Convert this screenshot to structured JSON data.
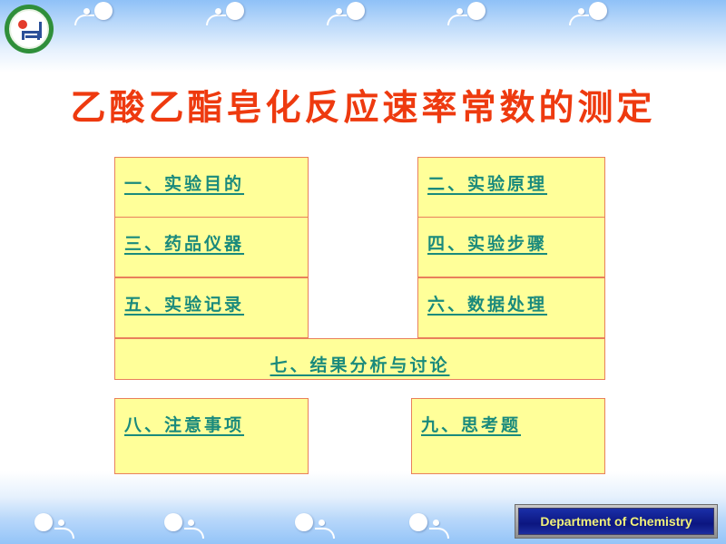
{
  "slide": {
    "title": "乙酸乙酯皂化反应速率常数的测定",
    "colors": {
      "title": "#ee3a0f",
      "link": "#1a8a7c",
      "box_fill": "#ffff99",
      "box_border": "#e9805b"
    },
    "menu": [
      {
        "label": "一、实验目的"
      },
      {
        "label": "二、实验原理"
      },
      {
        "label": "三、药品仪器"
      },
      {
        "label": "四、实验步骤"
      },
      {
        "label": "五、实验记录"
      },
      {
        "label": "六、数据处理"
      },
      {
        "label": "七、结果分析与讨论"
      },
      {
        "label": "八、注意事项"
      },
      {
        "label": "九、思考题"
      }
    ],
    "footer_badge": "Department of Chemistry",
    "logo_icon": "university-logo-icon",
    "decoration_icon": "flower-icon"
  }
}
